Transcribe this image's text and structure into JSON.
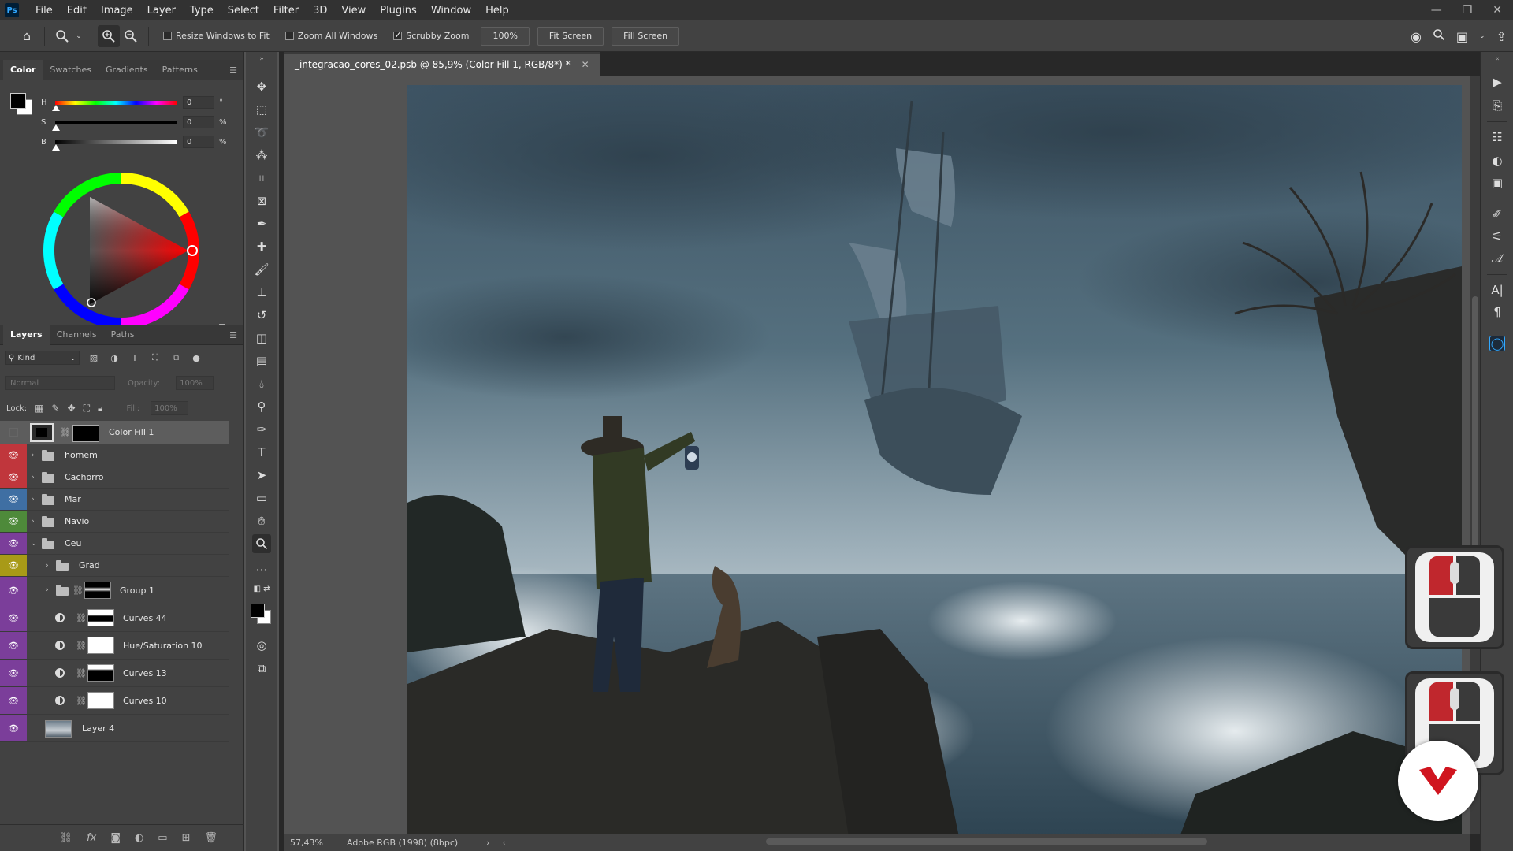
{
  "app": {
    "logo": "Ps"
  },
  "menu": [
    "File",
    "Edit",
    "Image",
    "Layer",
    "Type",
    "Select",
    "Filter",
    "3D",
    "View",
    "Plugins",
    "Window",
    "Help"
  ],
  "options_bar": {
    "resize_windows": "Resize Windows to Fit",
    "zoom_all": "Zoom All Windows",
    "scrubby_zoom": "Scrubby Zoom",
    "zoom_value": "100%",
    "fit_screen": "Fit Screen",
    "fill_screen": "Fill Screen"
  },
  "color_panel": {
    "tabs": [
      "Color",
      "Swatches",
      "Gradients",
      "Patterns"
    ],
    "sliders": [
      {
        "letter": "H",
        "value": "0",
        "unit": "°"
      },
      {
        "letter": "S",
        "value": "0",
        "unit": "%"
      },
      {
        "letter": "B",
        "value": "0",
        "unit": "%"
      }
    ],
    "foreground": "#000000",
    "background": "#ffffff"
  },
  "layers_panel": {
    "tabs": [
      "Layers",
      "Channels",
      "Paths"
    ],
    "kind": "Kind",
    "blend_mode": "Normal",
    "opacity_label": "Opacity:",
    "opacity_value": "100%",
    "lock_label": "Lock:",
    "fill_label": "Fill:",
    "fill_value": "100%",
    "layers": [
      {
        "name": "Color Fill 1",
        "eye_color": "",
        "type": "fill"
      },
      {
        "name": "homem",
        "eye_color": "#c0363c",
        "type": "group"
      },
      {
        "name": "Cachorro",
        "eye_color": "#c0363c",
        "type": "group"
      },
      {
        "name": "Mar",
        "eye_color": "#3f6fa3",
        "type": "group"
      },
      {
        "name": "Navio",
        "eye_color": "#4e8a3a",
        "type": "group"
      },
      {
        "name": "Ceu",
        "eye_color": "#7b3e9a",
        "type": "group-open"
      },
      {
        "name": "Grad",
        "eye_color": "#a89a17",
        "type": "group"
      },
      {
        "name": "Group 1",
        "eye_color": "#7b3e9a",
        "type": "group-mask"
      },
      {
        "name": "Curves 44",
        "eye_color": "#7b3e9a",
        "type": "adj"
      },
      {
        "name": "Hue/Saturation 10",
        "eye_color": "#7b3e9a",
        "type": "adj"
      },
      {
        "name": "Curves 13",
        "eye_color": "#7b3e9a",
        "type": "adj"
      },
      {
        "name": "Curves 10",
        "eye_color": "#7b3e9a",
        "type": "adj"
      },
      {
        "name": "Layer 4",
        "eye_color": "#7b3e9a",
        "type": "pixel"
      }
    ]
  },
  "document": {
    "tab_title": "_integracao_cores_02.psb @ 85,9% (Color Fill 1, RGB/8*) *",
    "zoom": "57,43%",
    "profile": "Adobe RGB (1998) (8bpc)"
  }
}
